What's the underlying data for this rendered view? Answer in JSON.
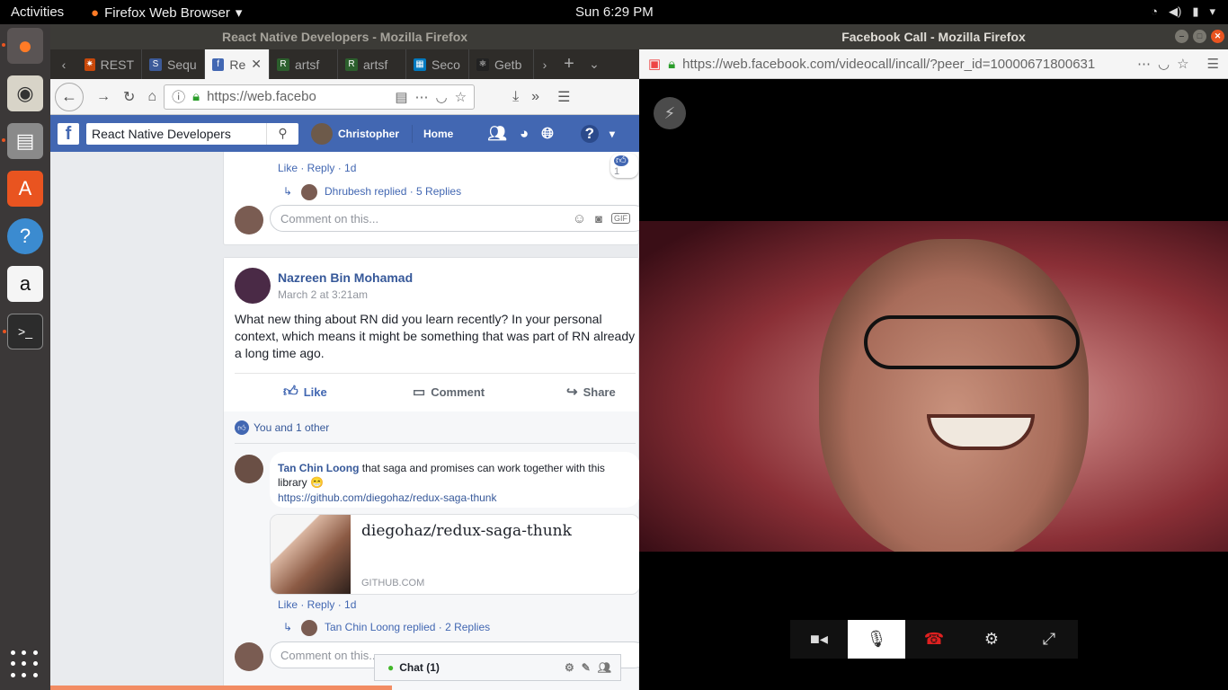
{
  "topbar": {
    "activities": "Activities",
    "app": "Firefox Web Browser",
    "clock": "Sun  6:29 PM"
  },
  "left": {
    "title": "React Native Developers - Mozilla Firefox",
    "tabs": [
      "REST",
      "Sequ",
      "Re",
      "artsf",
      "artsf",
      "Seco",
      "Getb"
    ],
    "url": "https://web.facebo",
    "fb": {
      "search": "React Native Developers",
      "user": "Christopher",
      "home": "Home"
    },
    "c1": {
      "actions": "Like · Reply · 1d",
      "replied": "Dhrubesh replied · 5 Replies",
      "reaction_count": "1",
      "placeholder": "Comment on this..."
    },
    "post": {
      "author": "Nazreen Bin Mohamad",
      "time": "March 2 at 3:21am",
      "text": "What new thing about RN did you learn recently? In your personal context, which means it might be something that was part of RN already a long time ago.",
      "like": "Like",
      "comment": "Comment",
      "share": "Share",
      "reactions": "You and 1 other"
    },
    "comment": {
      "author": "Tan Chin Loong",
      "text": "that saga and promises can work together with this library 😁",
      "link": "https://github.com/diegohaz/redux-saga-thunk",
      "preview_title": "diegohaz/redux-saga-thunk",
      "preview_domain": "GITHUB.COM",
      "actions": "Like · Reply · 1d",
      "replied": "Tan Chin Loong replied · 2 Replies",
      "placeholder": "Comment on this..."
    },
    "chat": "Chat (1)"
  },
  "right": {
    "title": "Facebook Call - Mozilla Firefox",
    "url": "https://web.facebook.com/videocall/incall/?peer_id=10000671800631"
  }
}
